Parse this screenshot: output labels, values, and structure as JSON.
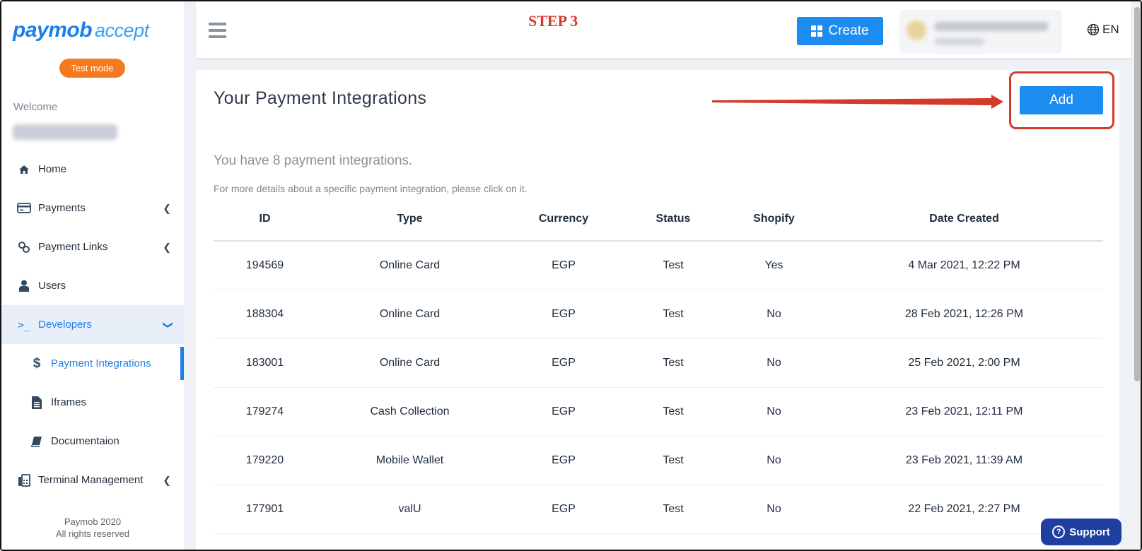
{
  "brand": {
    "logo": "paymob",
    "logo_sub": "accept",
    "mode_badge": "Test mode"
  },
  "sidebar": {
    "welcome": "Welcome",
    "items": [
      {
        "label": "Home",
        "icon": "home-icon"
      },
      {
        "label": "Payments",
        "icon": "card-icon"
      },
      {
        "label": "Payment Links",
        "icon": "link-icon"
      },
      {
        "label": "Users",
        "icon": "user-icon"
      },
      {
        "label": "Developers",
        "icon": "terminal-icon"
      },
      {
        "label": "Payment Integrations",
        "icon": "dollar-icon"
      },
      {
        "label": "Iframes",
        "icon": "file-icon"
      },
      {
        "label": "Documentaion",
        "icon": "book-icon"
      },
      {
        "label": "Terminal Management",
        "icon": "fax-icon"
      }
    ],
    "footer_brand": "Paymob",
    "footer_year": "2020",
    "footer_rights": "All rights reserved"
  },
  "topbar": {
    "annotation": "STEP 3",
    "create_label": "Create",
    "language": "EN"
  },
  "main": {
    "title": "Your Payment Integrations",
    "add_label": "Add",
    "count_text": "You have 8 payment integrations.",
    "hint_text": "For more details about a specific payment integration, please click on it.",
    "columns": [
      "ID",
      "Type",
      "Currency",
      "Status",
      "Shopify",
      "Date Created"
    ],
    "rows": [
      [
        "194569",
        "Online Card",
        "EGP",
        "Test",
        "Yes",
        "4 Mar 2021, 12:22 PM"
      ],
      [
        "188304",
        "Online Card",
        "EGP",
        "Test",
        "No",
        "28 Feb 2021, 12:26 PM"
      ],
      [
        "183001",
        "Online Card",
        "EGP",
        "Test",
        "No",
        "25 Feb 2021, 2:00 PM"
      ],
      [
        "179274",
        "Cash Collection",
        "EGP",
        "Test",
        "No",
        "23 Feb 2021, 12:11 PM"
      ],
      [
        "179220",
        "Mobile Wallet",
        "EGP",
        "Test",
        "No",
        "23 Feb 2021, 11:39 AM"
      ],
      [
        "177901",
        "valU",
        "EGP",
        "Test",
        "No",
        "22 Feb 2021, 2:27 PM"
      ]
    ]
  },
  "support_label": "Support",
  "colors": {
    "accent": "#1d8cf0",
    "annotation": "#d23a2a",
    "badge": "#f57a1f",
    "support": "#1f3fa3"
  }
}
